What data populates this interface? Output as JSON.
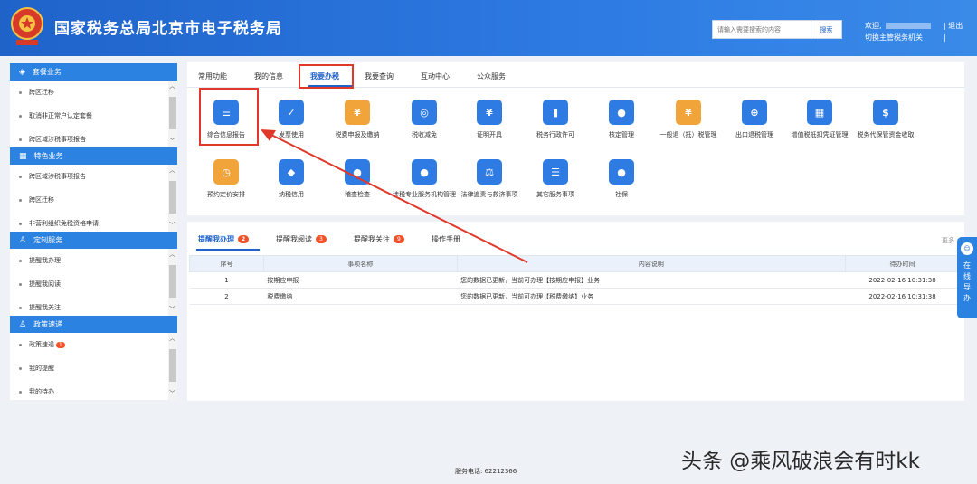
{
  "header": {
    "title": "国家税务总局北京市电子税务局",
    "search_placeholder": "请输入需要搜索的内容",
    "search_button": "搜索",
    "welcome": "欢迎,",
    "switch_authority": "切换主管税务机关",
    "logout": "退出"
  },
  "sidebar": {
    "groups": [
      {
        "title": "套餐业务",
        "icon": "cube-icon",
        "items": [
          "跨区迁移",
          "取消非正常户认定套餐",
          "跨区域涉税事项报告"
        ]
      },
      {
        "title": "特色业务",
        "icon": "grid-icon",
        "items": [
          "跨区域涉税事项报告",
          "跨区迁移",
          "非营利组织免税资格申请"
        ]
      },
      {
        "title": "定制服务",
        "icon": "user-icon",
        "items": [
          "提醒我办理",
          "提醒我阅读",
          "提醒我关注"
        ]
      },
      {
        "title": "政策速递",
        "icon": "user-icon",
        "items": [
          "政策速递",
          "我的提醒",
          "我的待办"
        ],
        "badge": "1"
      }
    ]
  },
  "tabs": [
    "常用功能",
    "我的信息",
    "我要办税",
    "我要查询",
    "互动中心",
    "公众服务"
  ],
  "services": [
    {
      "label": "综合信息报告",
      "color": "#2d7be3",
      "glyph": "☰"
    },
    {
      "label": "发票使用",
      "color": "#2d7be3",
      "glyph": "✓"
    },
    {
      "label": "税费申报及缴纳",
      "color": "#f0a43a",
      "glyph": "¥"
    },
    {
      "label": "税收减免",
      "color": "#2d7be3",
      "glyph": "◎"
    },
    {
      "label": "证明开具",
      "color": "#2d7be3",
      "glyph": "¥"
    },
    {
      "label": "税务行政许可",
      "color": "#2d7be3",
      "glyph": "▮"
    },
    {
      "label": "核定管理",
      "color": "#2d7be3",
      "glyph": "●"
    },
    {
      "label": "一般退（抵）税管理",
      "color": "#f0a43a",
      "glyph": "¥"
    },
    {
      "label": "出口退税管理",
      "color": "#2d7be3",
      "glyph": "⊕"
    },
    {
      "label": "增值税抵扣凭证管理",
      "color": "#2d7be3",
      "glyph": "▦"
    },
    {
      "label": "税务代保管资金收取",
      "color": "#2d7be3",
      "glyph": "$"
    },
    {
      "label": "预约定价安排",
      "color": "#f0a43a",
      "glyph": "◷"
    },
    {
      "label": "纳税信用",
      "color": "#2d7be3",
      "glyph": "◆"
    },
    {
      "label": "稽查检查",
      "color": "#2d7be3",
      "glyph": "●"
    },
    {
      "label": "涉税专业服务机构管理",
      "color": "#2d7be3",
      "glyph": "●"
    },
    {
      "label": "法律追责与救济事项",
      "color": "#2d7be3",
      "glyph": "⚖"
    },
    {
      "label": "其它服务事项",
      "color": "#2d7be3",
      "glyph": "☰"
    },
    {
      "label": "社保",
      "color": "#2d7be3",
      "glyph": "●"
    }
  ],
  "bottom_tabs": [
    {
      "label": "提醒我办理",
      "badge": "2"
    },
    {
      "label": "提醒我阅读",
      "badge": "3"
    },
    {
      "label": "提醒我关注",
      "badge": "9"
    },
    {
      "label": "操作手册",
      "badge": ""
    }
  ],
  "more": "更多",
  "table": {
    "headers": [
      "序号",
      "事项名称",
      "内容说明",
      "待办时间"
    ],
    "rows": [
      [
        "1",
        "按期应申报",
        "您的数据已更新，当前可办理【按期应申报】业务",
        "2022-02-16 10:31:38"
      ],
      [
        "2",
        "税费缴纳",
        "您的数据已更新，当前可办理【税费缴纳】业务",
        "2022-02-16 10:31:38"
      ]
    ]
  },
  "footer": {
    "phone": "服务电话: 62212366"
  },
  "watermark": "头条 @乘风破浪会有时kk",
  "float_help": "在线导办"
}
